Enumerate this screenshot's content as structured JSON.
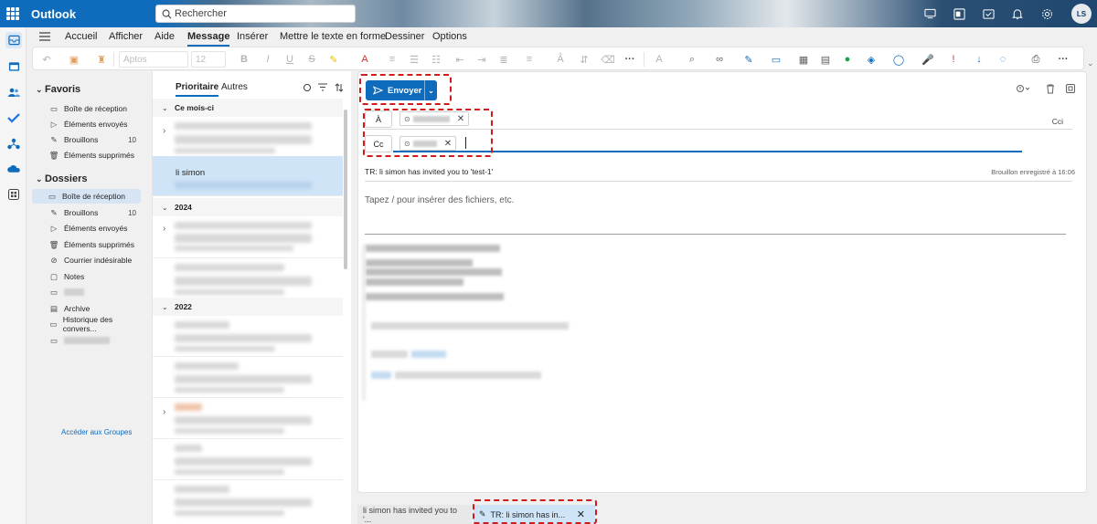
{
  "app": {
    "title": "Outlook"
  },
  "search": {
    "placeholder": "Rechercher"
  },
  "user": {
    "initials": "LS"
  },
  "menu": {
    "tabs": [
      "Accueil",
      "Afficher",
      "Aide",
      "Message",
      "Insérer",
      "Mettre le texte en forme",
      "Dessiner",
      "Options"
    ],
    "active": "Message"
  },
  "ribbon": {
    "font_name": "Aptos",
    "font_size": "12",
    "more": "···"
  },
  "folders": {
    "favorites_title": "Favoris",
    "favorites": [
      {
        "label": "Boîte de réception",
        "count": ""
      },
      {
        "label": "Éléments envoyés",
        "count": ""
      },
      {
        "label": "Brouillons",
        "count": "10"
      },
      {
        "label": "Éléments supprimés",
        "count": ""
      }
    ],
    "folders_title": "Dossiers",
    "items": [
      {
        "label": "Boîte de réception",
        "count": ""
      },
      {
        "label": "Brouillons",
        "count": "10"
      },
      {
        "label": "Éléments envoyés",
        "count": ""
      },
      {
        "label": "Éléments supprimés",
        "count": ""
      },
      {
        "label": "Courrier indésirable",
        "count": ""
      },
      {
        "label": "Notes",
        "count": ""
      },
      {
        "label": "",
        "count": ""
      },
      {
        "label": "Archive",
        "count": ""
      },
      {
        "label": "Historique des convers...",
        "count": ""
      },
      {
        "label": "",
        "count": ""
      }
    ],
    "groups_link": "Accéder aux Groupes"
  },
  "message_list": {
    "tabs": [
      "Prioritaire",
      "Autres"
    ],
    "groups": [
      "Ce mois-ci",
      "2024",
      "2022"
    ],
    "selected_sender": "li simon"
  },
  "compose": {
    "send_label": "Envoyer",
    "to_label": "À",
    "cc_label": "Cc",
    "bcc_label": "Cci",
    "subject": "TR: li simon has invited you to 'test-1'",
    "saved_status": "Brouillon enregistré à 16:06",
    "body_placeholder": "Tapez / pour insérer des fichiers, etc."
  },
  "bottom_tabs": [
    {
      "label": "li simon has invited you to '..."
    },
    {
      "label": "TR: li simon has in..."
    }
  ],
  "colors": {
    "accent": "#0f6cbd",
    "highlight": "#d11b1b"
  }
}
